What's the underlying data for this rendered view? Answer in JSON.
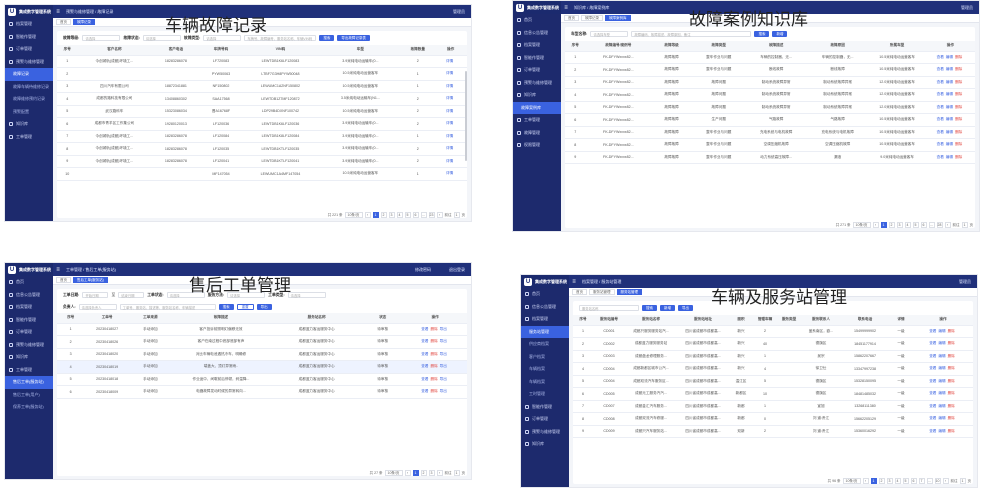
{
  "app_name": "集成数字管理系统",
  "p1": {
    "title": "车辆故障记录",
    "crumb": "预警与维修管理 / 故障记录",
    "topright": "管理员",
    "tabs": [
      "首页",
      "故障记录"
    ],
    "sidebar": [
      {
        "label": "档案管理"
      },
      {
        "label": "智能作管理"
      },
      {
        "label": "订单管理"
      },
      {
        "label": "预警与维修管理"
      },
      {
        "label": "故障记录",
        "active": true,
        "sub": true
      },
      {
        "label": "故障车辆待维修记录",
        "sub": true
      },
      {
        "label": "故障维修预约记录",
        "sub": true
      },
      {
        "label": "预警配置",
        "sub": true
      },
      {
        "label": "知识库"
      },
      {
        "label": "工单管理"
      }
    ],
    "filters": {
      "f1_label": "故障等级:",
      "f1_ph": "请选择",
      "f2_label": "故障状态:",
      "f2_ph": "请选择",
      "f3_label": "故障类型:",
      "f3_ph": "请选择",
      "search_ph": "车牌号、故障编号、服务站名称、车辆VIN码",
      "search_btn": "搜索",
      "export_btn": "导出故障记录表"
    },
    "columns": [
      "序号",
      "客户名称",
      "客户电话",
      "车牌号码",
      "VIN码",
      "车型",
      "故障数量",
      "操作"
    ],
    "rows": [
      [
        "1",
        "今创城轨(成都)环境工...",
        "18283286078",
        "LF720083",
        "LEWTDB1K6LF120083",
        "3.9米纯电动运输车(0...",
        "2",
        "详情"
      ],
      [
        "2",
        "",
        "",
        "PYW50063",
        "LTBF7G3H8PYW50048",
        "10.5米纯电动运营客车",
        "1",
        "详情"
      ],
      [
        "3",
        "四川汽车有限公司",
        "18872341881",
        "NF150802",
        "LEWUMC1A2NF150802",
        "10.5米纯电动运营客车",
        "1",
        "详情"
      ],
      [
        "4",
        "成都的路科技有限公司",
        "13408860302",
        "SAA17568",
        "LEWTDB1Z7MF120872",
        "3.5米纯电动运输车(N1...",
        "2",
        "详情"
      ],
      [
        "5",
        "武汉路科车",
        "15323086034",
        "晋A16768F",
        "LDP29B4DXNF100742",
        "10.5米纯电动运营客车",
        "2",
        "详情"
      ],
      [
        "6",
        "成都市青羊区工作集公司",
        "19280120013",
        "LF120036",
        "LEWTDB1K6LF120036",
        "3.9米纯电动运输车(0...",
        "2",
        "详情"
      ],
      [
        "7",
        "今创城轨(成都)环境工...",
        "18283286078",
        "LF120084",
        "LEWTDB1K8LF120084",
        "3.9米纯电动运输车(0...",
        "1",
        "详情"
      ],
      [
        "8",
        "今创城轨(成都)环境工...",
        "18283286078",
        "LF120035",
        "LEWTDB1KTLF120035",
        "3.9米纯电动运输车(0...",
        "2",
        "详情"
      ],
      [
        "9",
        "今创城轨(成都)环境工...",
        "18283286078",
        "LF120041",
        "LEWTDB1KTLF120041",
        "3.9米纯电动运输车(0...",
        "2",
        "详情"
      ],
      [
        "10",
        "",
        "",
        "MF147054",
        "LEWUMC1A4MF147054",
        "10.5米纯电动运营客车",
        "1",
        "详情"
      ]
    ],
    "pager": {
      "total": "共 221 条",
      "size": "10条/页",
      "pages": [
        "1",
        "2",
        "3",
        "4",
        "5",
        "6",
        "...",
        "23"
      ],
      "active": "1",
      "goto": "前往",
      "page": "1",
      "unit": "页"
    }
  },
  "p2": {
    "title": "故障案例知识库",
    "crumb": "知识库 / 故障案例库",
    "topright": "管理员",
    "tabs": [
      "首页",
      "故障记录",
      "故障案例库"
    ],
    "sidebar": [
      {
        "label": "首页"
      },
      {
        "label": "信息公告管理"
      },
      {
        "label": "档案管理"
      },
      {
        "label": "智能作管理"
      },
      {
        "label": "订单管理"
      },
      {
        "label": "预警与维修管理"
      },
      {
        "label": "知识库"
      },
      {
        "label": "故障案例库",
        "active": true,
        "sub": true
      },
      {
        "label": "工单管理"
      },
      {
        "label": "故障管理"
      },
      {
        "label": "权限管理"
      }
    ],
    "filters": {
      "f1_label": "车型名称:",
      "f1_ph": "请选择车型",
      "search_ph": "故障编码、故障描述、故障原因、备注",
      "search_btn": "搜索",
      "add_btn": "新增"
    },
    "columns": [
      "序号",
      "故障编号/案例号",
      "故障等级",
      "故障类型",
      "故障描述",
      "故障原因",
      "所属车型",
      "操作"
    ],
    "rows": [
      [
        "1",
        "FK-DFYWxxxx82...",
        "故障故障",
        "整车作业与问题",
        "车辆的控制器，无...",
        "车辆的控制器，无...",
        "10.5米纯电动运营客车",
        "查看 编辑 删除"
      ],
      [
        "2",
        "FK-DFYWxxxx82...",
        "故障故障",
        "整车作业与问题",
        "断线故障",
        "断线故障",
        "10.5米纯电动运营客车",
        "查看 编辑 删除"
      ],
      [
        "3",
        "FK-DFYWxxxx82...",
        "故障故障",
        "故障问题",
        "制动系统故障异常",
        "制动系统故障异常",
        "12.0米纯电动运营客车",
        "查看 编辑 删除"
      ],
      [
        "4",
        "FK-DFYWxxxx82...",
        "故障故障",
        "故障问题",
        "制动系统故障异常",
        "制动系统故障异常",
        "12.0米纯电动运营客车",
        "查看 编辑 删除"
      ],
      [
        "5",
        "FK-DFYWxxxx82...",
        "故障故障",
        "故障问题",
        "制动系统故障异常",
        "制动系统故障异常",
        "12.0米纯电动运营客车",
        "查看 编辑 删除"
      ],
      [
        "6",
        "FK-DFYWxxxx82...",
        "故障故障",
        "生产问题",
        "气路故障",
        "气路故障",
        "10.5米纯电动运营客车",
        "查看 编辑 删除"
      ],
      [
        "7",
        "FK-DFYWxxxx82...",
        "故障故障",
        "整车作业与问题",
        "充电系统与电机故障",
        "充电系统与电机故障",
        "10.5米纯电动运营客车",
        "查看 编辑 删除"
      ],
      [
        "8",
        "FK-DFYWxxxx82...",
        "故障故障",
        "整车作业与问题",
        "空调压缩机故障",
        "空调压缩机故障",
        "10.5米纯电动运营客车",
        "查看 编辑 删除"
      ],
      [
        "9",
        "FK-DFYWxxxx82...",
        "故障故障",
        "整车作业与问题",
        "动力系统高压故障...",
        "漏液",
        "9.0米纯电动运营客车",
        "查看 编辑 删除"
      ]
    ],
    "pager": {
      "total": "共 271 条",
      "size": "10条/页",
      "pages": [
        "1",
        "2",
        "3",
        "4",
        "5",
        "6",
        "...",
        "28"
      ],
      "active": "1",
      "goto": "前往",
      "page": "1",
      "unit": "页"
    }
  },
  "p3": {
    "title": "售后工单管理",
    "crumb": "工单管理 / 售后工单(服务站)",
    "topright_link": "修改密码",
    "topright": "退出登录",
    "tabs": [
      "首页",
      "售后工单(服务站)"
    ],
    "sidebar": [
      {
        "label": "首页"
      },
      {
        "label": "信息公告管理"
      },
      {
        "label": "档案管理"
      },
      {
        "label": "智能作管理"
      },
      {
        "label": "订单管理"
      },
      {
        "label": "预警与维修管理"
      },
      {
        "label": "知识库"
      },
      {
        "label": "工单管理"
      },
      {
        "label": "售后工单(服务站)",
        "active": true,
        "sub": true
      },
      {
        "label": "售后工单(用户)",
        "sub": true
      },
      {
        "label": "保养工单(服务站)",
        "sub": true
      }
    ],
    "filters": {
      "date_label": "工单日期:",
      "date_from": "开始日期",
      "date_sep": "至",
      "date_to": "结束日期",
      "status_label": "工单状态:",
      "status_ph": "请选择",
      "method_label": "服务方法:",
      "method_ph": "请选择",
      "type_label": "工单类型:",
      "type_ph": "请选择",
      "owner_label": "负责人:",
      "owner_ph": "请选择负责人",
      "search_ph": "工单号、服务站、描述等、服务站名称、车辆描述",
      "search_btn": "搜索",
      "reset_btn": "重置",
      "export_btn": "导出"
    },
    "columns": [
      "序号",
      "工单号",
      "工单来源",
      "故障描述",
      "服务站名称",
      "状态",
      "操作"
    ],
    "rows": [
      [
        "1",
        "20230418027",
        "手动添加",
        "客户投诉前照明灯偏移无效",
        "成都蓝力客运服务中心",
        "待审核",
        "查看 删除 导出"
      ],
      [
        "2",
        "20230418026",
        "手动添加",
        "客户在南过程中底部底部有声",
        "成都蓝力客运服务中心",
        "待审核",
        "查看 删除 导出"
      ],
      [
        "3",
        "20230418020",
        "手动添加",
        "对比车辆电池遇热冷车，明确修",
        "成都蓝力客运服务中心",
        "待审核",
        "查看 删除 导出"
      ],
      [
        "4",
        "20230418019",
        "手动添加",
        "端盖大、顶灯异常雨..",
        "成都蓝力客运服务中心",
        "待审核",
        "查看 删除 导出"
      ],
      [
        "5",
        "20230418018",
        "手动添加",
        "作业途中，间歇前后停顿，刹温降...",
        "成都蓝力客运服务中心",
        "待审核",
        "查看 删除 导出"
      ],
      [
        "6",
        "20230418009",
        "手动添加",
        "电器故障发动时候的异常转向...",
        "成都蓝力客运服务中心",
        "待审核",
        "查看 删除 导出"
      ]
    ],
    "pager": {
      "total": "共 27 条",
      "size": "10条/页",
      "pages": [
        "1",
        "2",
        "3"
      ],
      "active": "1",
      "goto": "前往",
      "page": "1",
      "unit": "页"
    }
  },
  "p4": {
    "title": "车辆及服务站管理",
    "crumb": "档案管理 / 服务站管理",
    "topright": "管理员",
    "tabs": [
      "首页",
      "服务站管理",
      "服务站管理"
    ],
    "sidebar": [
      {
        "label": "首页"
      },
      {
        "label": "信息公告管理"
      },
      {
        "label": "档案管理"
      },
      {
        "label": "服务站管理",
        "active": true,
        "sub": true
      },
      {
        "label": "供应商档案",
        "sub": true
      },
      {
        "label": "客户档案",
        "sub": true
      },
      {
        "label": "车辆档案",
        "sub": true
      },
      {
        "label": "车辆档案",
        "sub": true
      },
      {
        "label": "工时管理",
        "sub": true
      },
      {
        "label": "智能作管理"
      },
      {
        "label": "订单管理"
      },
      {
        "label": "预警与维修管理"
      },
      {
        "label": "知识库"
      }
    ],
    "filters": {
      "search_ph": "服务站名称",
      "search_btn": "搜索",
      "add_btn": "新增",
      "export_btn": "导出"
    },
    "columns": [
      "序号",
      "服务站编号",
      "服务站名称",
      "服务站地址",
      "面积",
      "管理车辆",
      "服务类型",
      "服务联系人",
      "联系电话",
      "详情",
      "操作"
    ],
    "rows": [
      [
        "1",
        "CD001",
        "成都只服务服务站汽...",
        "四川省成都市成都高...",
        "新兴",
        "2",
        "",
        "盖系南区，欧...",
        "15499999902",
        "一级",
        "查看 编辑 删除"
      ],
      [
        "2",
        "CD002",
        "成都蓝力服务服务站",
        "四川省成都市成都高...",
        "新兴",
        "40",
        "",
        "德旗区",
        "18451177914",
        "一级",
        "查看 编辑 删除"
      ],
      [
        "3",
        "CD003",
        "成都盘龙修理服务...",
        "四川省成都市成都高...",
        "新兴",
        "1",
        "",
        "吴宗",
        "15862207667",
        "一级",
        "查看 编辑 删除"
      ],
      [
        "4",
        "CD004",
        "成都新都区城市公汽...",
        "四川省成都市成都高...",
        "新兴",
        "4",
        "",
        "徐卫仕",
        "13347997238",
        "一级",
        "查看 编辑 删除"
      ],
      [
        "5",
        "CD004",
        "成都双流汽车服务区...",
        "四川省成都市成都高...",
        "温江区",
        "5",
        "",
        "德旗区",
        "15328150095",
        "一级",
        "查看 编辑 删除"
      ],
      [
        "6",
        "CD005",
        "成都元工服务汽汽...",
        "四川省成都市成都高...",
        "新都区",
        "10",
        "",
        "德旗区",
        "18481485032",
        "一级",
        "查看 编辑 删除"
      ],
      [
        "7",
        "CD007",
        "成都金汇汽车服务...",
        "四川省成都市成都高...",
        "新都",
        "1",
        "",
        "宣旭",
        "13268111380",
        "一级",
        "查看 编辑 删除"
      ],
      [
        "8",
        "CD008",
        "成都双流汽车修服...",
        "四川省成都市成都高...",
        "新都",
        "0",
        "",
        "刘 道:贵江",
        "15662205129",
        "一级",
        "查看 编辑 删除"
      ],
      [
        "9",
        "CD009",
        "成都只汽车服务站...",
        "四川省成都市成都高...",
        "双新",
        "2",
        "",
        "刘 道:贵江",
        "15360016292",
        "一级",
        "查看 编辑 删除"
      ]
    ],
    "pager": {
      "total": "共 96 条",
      "size": "10条/页",
      "pages": [
        "1",
        "2",
        "3",
        "4",
        "5",
        "6",
        "7",
        "...",
        "10"
      ],
      "active": "1",
      "goto": "前往",
      "page": "1",
      "unit": "页"
    }
  }
}
